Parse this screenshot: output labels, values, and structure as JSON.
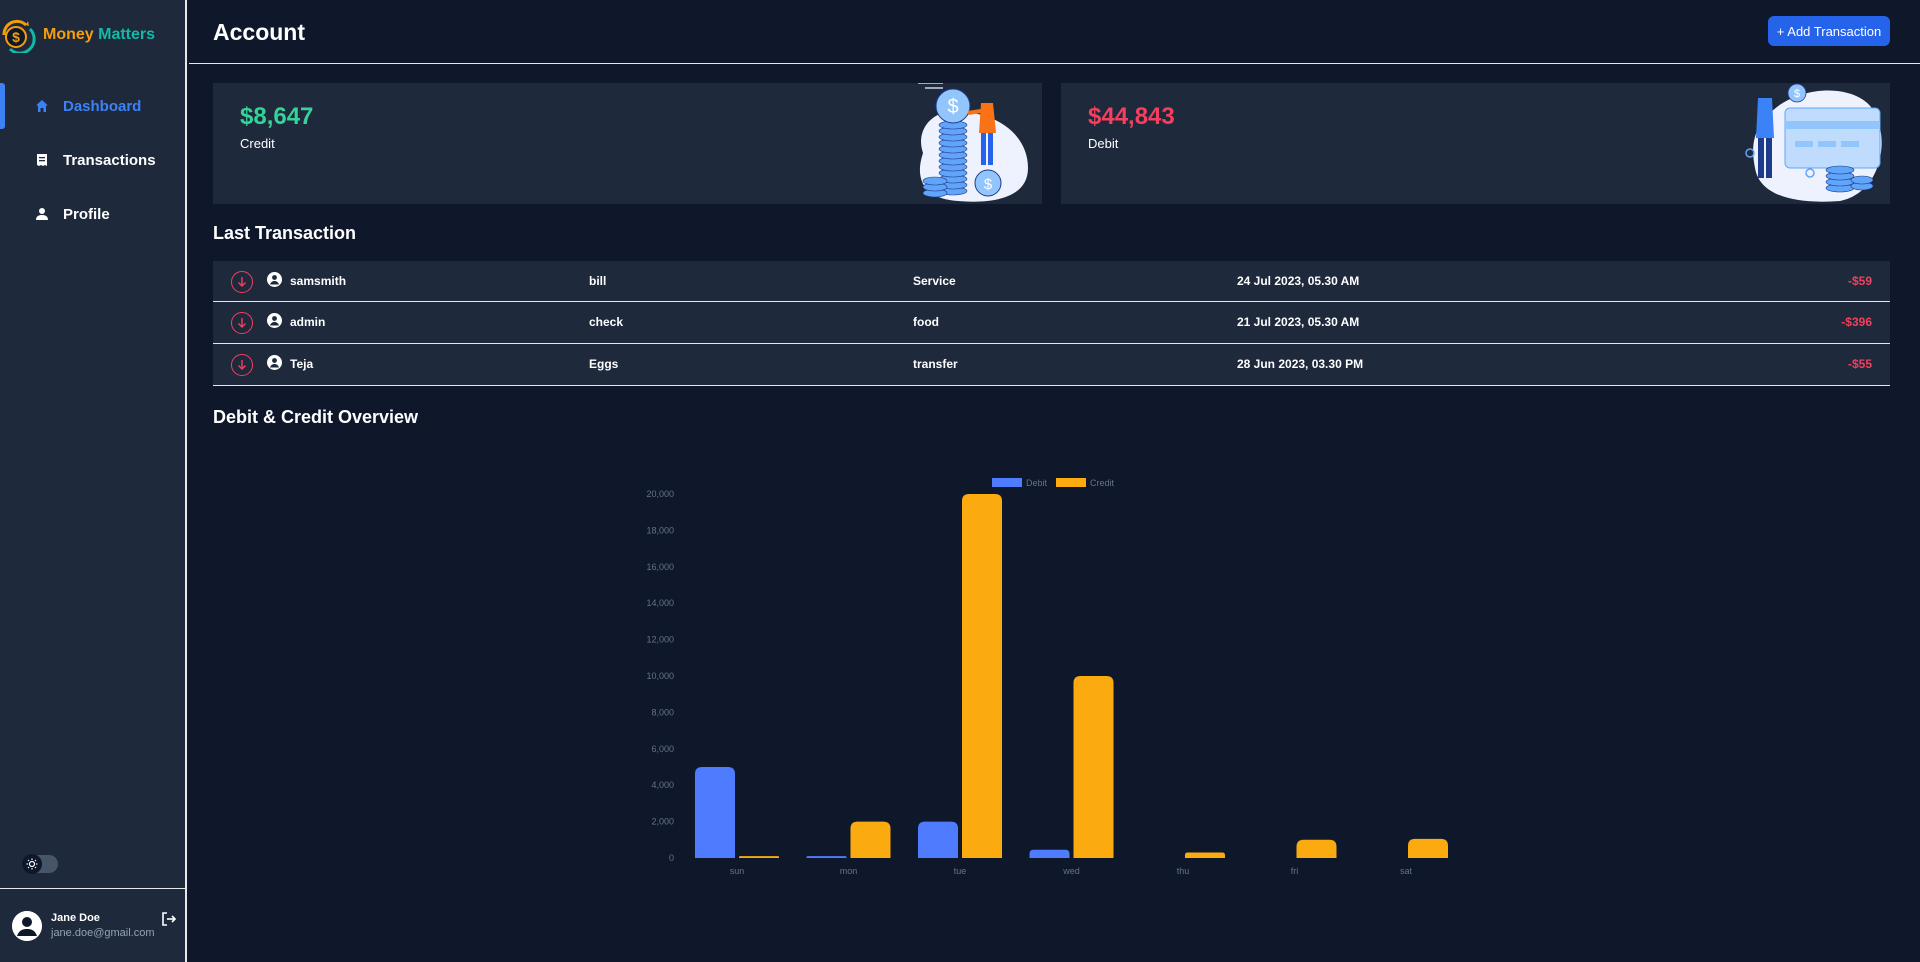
{
  "app": {
    "brand_part1": "Money",
    "brand_part2": "Matters"
  },
  "sidebar": {
    "items": [
      {
        "label": "Dashboard",
        "icon": "home-icon",
        "active": true
      },
      {
        "label": "Transactions",
        "icon": "receipt-icon",
        "active": false
      },
      {
        "label": "Profile",
        "icon": "user-icon",
        "active": false
      }
    ],
    "theme_toggle_icon": "sun-icon"
  },
  "user": {
    "name": "Jane Doe",
    "email": "jane.doe@gmail.com"
  },
  "header": {
    "title": "Account",
    "add_button": "+ Add Transaction"
  },
  "summary": {
    "credit": {
      "amount": "$8,647",
      "label": "Credit",
      "color": "#34d399"
    },
    "debit": {
      "amount": "$44,843",
      "label": "Debit",
      "color": "#f43f5e"
    }
  },
  "transactions": {
    "title": "Last Transaction",
    "rows": [
      {
        "user": "samsmith",
        "name": "bill",
        "category": "Service",
        "date": "24 Jul 2023, 05.30 AM",
        "amount": "-$59"
      },
      {
        "user": "admin",
        "name": "check",
        "category": "food",
        "date": "21 Jul 2023, 05.30 AM",
        "amount": "-$396"
      },
      {
        "user": "Teja",
        "name": "Eggs",
        "category": "transfer",
        "date": "28 Jun 2023, 03.30 PM",
        "amount": "-$55"
      }
    ]
  },
  "overview": {
    "title": "Debit & Credit Overview"
  },
  "chart_data": {
    "type": "bar",
    "categories": [
      "sun",
      "mon",
      "tue",
      "wed",
      "thu",
      "fri",
      "sat"
    ],
    "series": [
      {
        "name": "Debit",
        "color": "#4f7cff",
        "values": [
          5000,
          100,
          2000,
          450,
          0,
          0,
          0
        ]
      },
      {
        "name": "Credit",
        "color": "#fbab10",
        "values": [
          100,
          2000,
          20000,
          10000,
          300,
          1000,
          1050
        ]
      }
    ],
    "ylim": [
      0,
      20000
    ],
    "yticks": [
      "0",
      "2,000",
      "4,000",
      "6,000",
      "8,000",
      "10,000",
      "12,000",
      "14,000",
      "16,000",
      "18,000",
      "20,000"
    ],
    "legend": "top-center",
    "grid": false
  }
}
